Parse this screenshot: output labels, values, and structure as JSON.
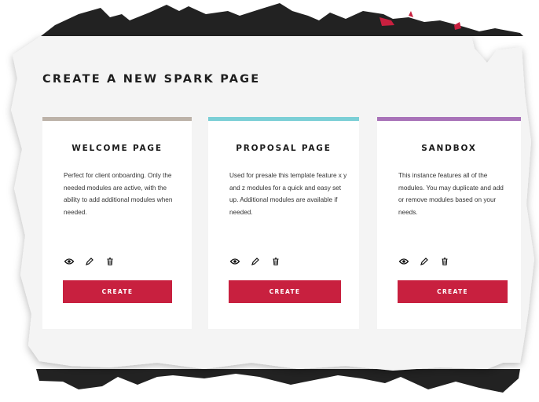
{
  "page": {
    "title": "CREATE A NEW SPARK PAGE"
  },
  "colors": {
    "accent": "#c8203f",
    "welcome_bar": "#bcb2a8",
    "proposal_bar": "#7bcfd6",
    "sandbox_bar": "#a872b8",
    "panel_bg": "#f4f4f4",
    "brush": "#222222"
  },
  "cards": [
    {
      "title": "WELCOME PAGE",
      "description": "Perfect for client onboarding. Only the needed modules are active, with the ability to add additional modules when needed.",
      "icons": [
        "eye-icon",
        "pencil-icon",
        "trash-icon"
      ],
      "button_label": "CREATE"
    },
    {
      "title": "PROPOSAL PAGE",
      "description": "Used for presale this template feature x y and z modules for a quick and easy set up. Additional modules are available if needed.",
      "icons": [
        "eye-icon",
        "pencil-icon",
        "trash-icon"
      ],
      "button_label": "CREATE"
    },
    {
      "title": "SANDBOX",
      "description": "This instance features all of the modules. You may duplicate and add or remove modules based on your needs.",
      "icons": [
        "eye-icon",
        "pencil-icon",
        "trash-icon"
      ],
      "button_label": "CREATE"
    }
  ]
}
